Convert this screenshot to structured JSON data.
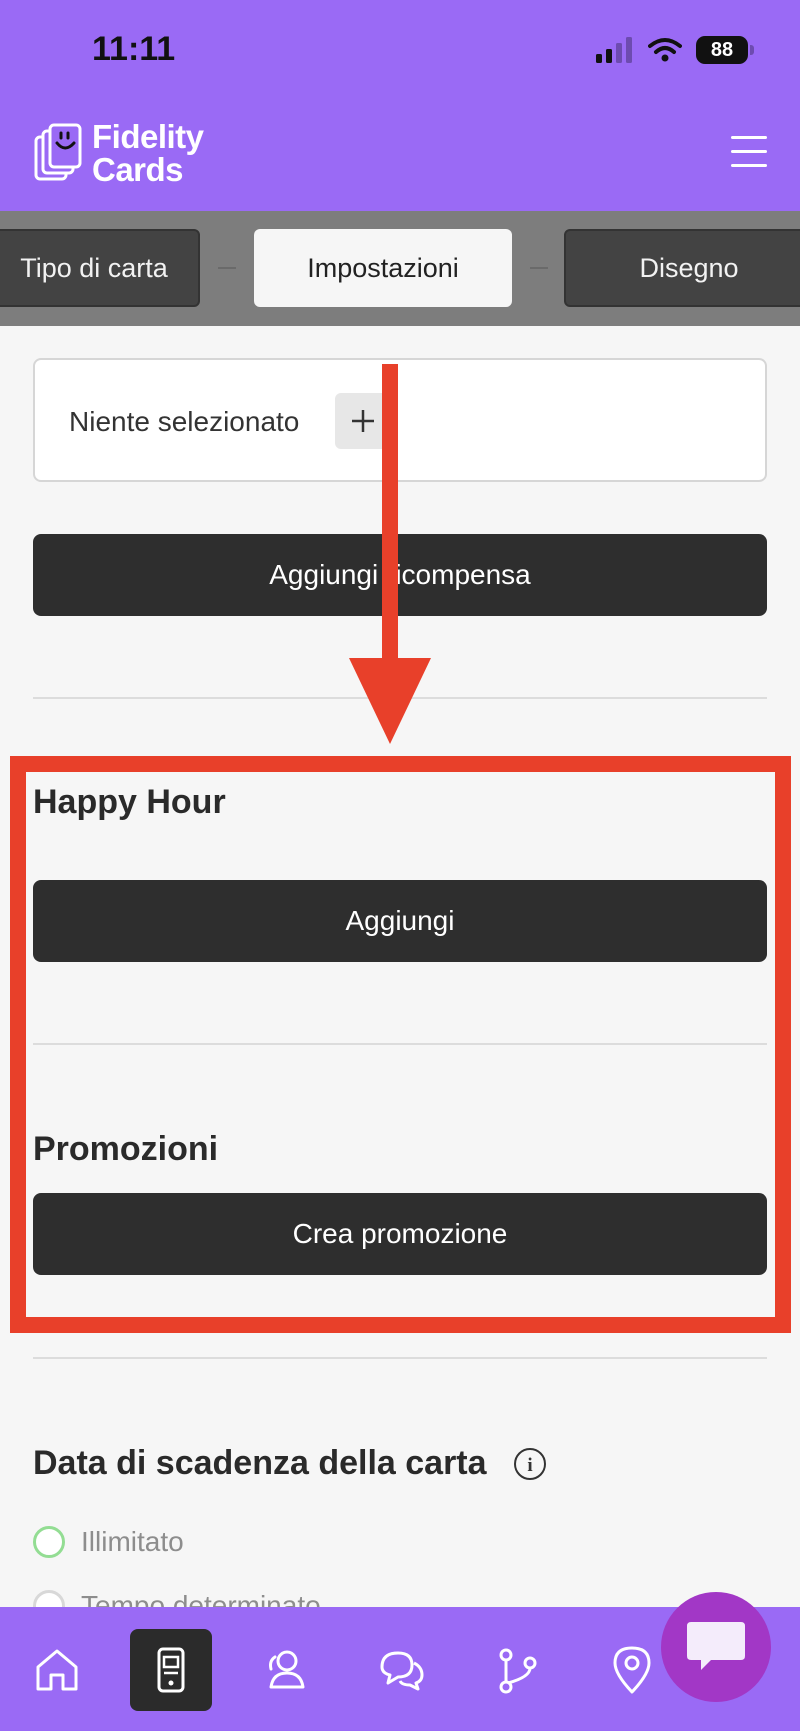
{
  "status_bar": {
    "time": "11:11",
    "battery": "88"
  },
  "header": {
    "logo_line1": "Fidelity",
    "logo_line2": "Cards"
  },
  "steps": [
    {
      "label": "Tipo di carta"
    },
    {
      "label": "Impostazioni"
    },
    {
      "label": "Disegno"
    }
  ],
  "reward": {
    "select_placeholder": "Niente selezionato",
    "add_button": "Aggiungi ricompensa"
  },
  "happy_hour": {
    "title": "Happy Hour",
    "add_button": "Aggiungi"
  },
  "promotions": {
    "title": "Promozioni",
    "create_button": "Crea promozione"
  },
  "expiry": {
    "title": "Data di scadenza della carta",
    "options": [
      {
        "label": "Illimitato"
      },
      {
        "label": "Tempo determinato"
      }
    ]
  },
  "colors": {
    "brand": "#9a6af5",
    "highlight": "#e8402a",
    "button_dark": "#2e2e2e",
    "chat": "#a237c6"
  },
  "bottom_nav": [
    {
      "icon": "home-icon"
    },
    {
      "icon": "card-phone-icon"
    },
    {
      "icon": "users-icon"
    },
    {
      "icon": "chat-icon"
    },
    {
      "icon": "flow-icon"
    },
    {
      "icon": "location-icon"
    }
  ]
}
